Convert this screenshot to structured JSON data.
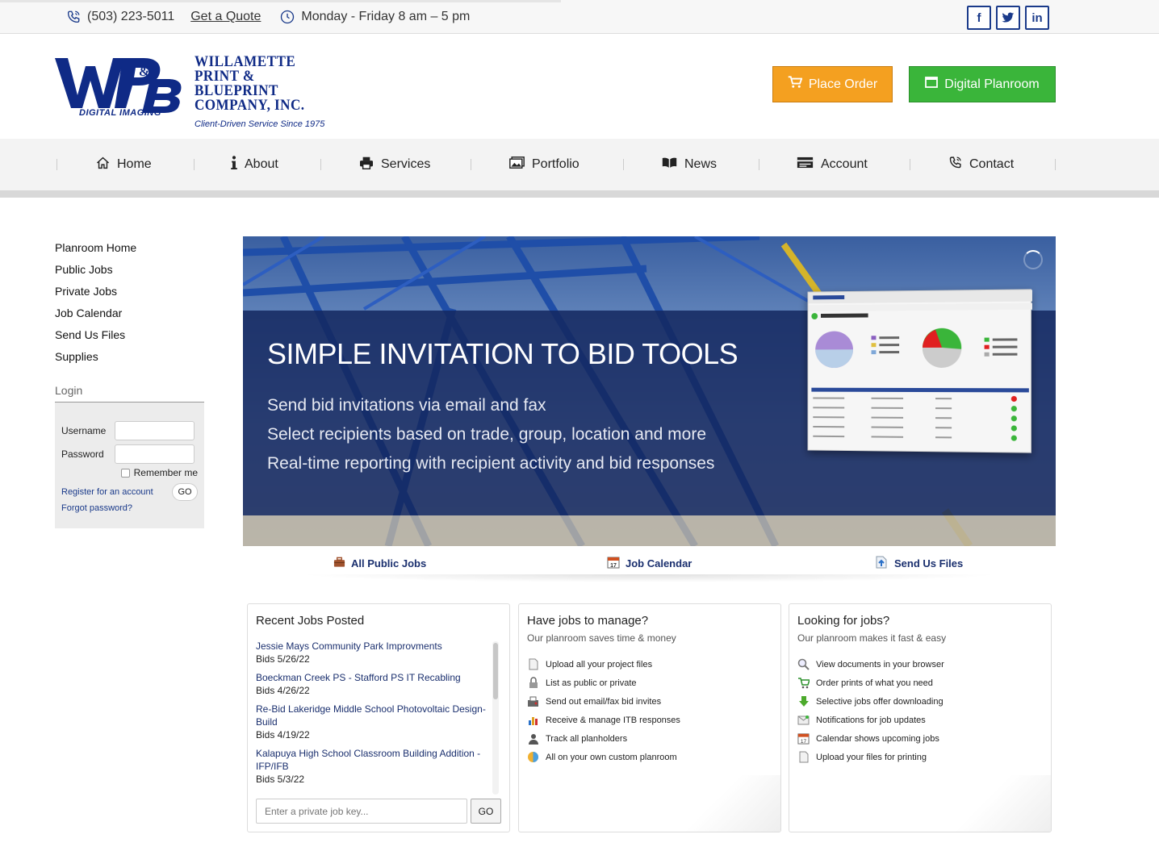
{
  "topbar": {
    "phone": "(503) 223-5011",
    "quote": "Get a Quote",
    "hours": "Monday - Friday 8 am – 5 pm",
    "social": [
      "f",
      "t",
      "in"
    ]
  },
  "logo": {
    "line1": "WILLAMETTE",
    "line2": "PRINT & BLUEPRINT",
    "line3": "COMPANY, INC.",
    "tagline": "Client-Driven Service Since 1975",
    "digital": "DIGITAL IMAGING",
    "mark": "WP&B"
  },
  "header": {
    "place_order": "Place Order",
    "digital_planroom": "Digital Planroom"
  },
  "nav": {
    "items": [
      {
        "label": "Home",
        "icon": "home-icon"
      },
      {
        "label": "About",
        "icon": "info-icon"
      },
      {
        "label": "Services",
        "icon": "printer-icon"
      },
      {
        "label": "Portfolio",
        "icon": "image-icon"
      },
      {
        "label": "News",
        "icon": "book-icon"
      },
      {
        "label": "Account",
        "icon": "card-icon"
      },
      {
        "label": "Contact",
        "icon": "phone-icon"
      }
    ]
  },
  "sidebar": {
    "links": [
      "Planroom Home",
      "Public Jobs",
      "Private Jobs",
      "Job Calendar",
      "Send Us Files",
      "Supplies"
    ],
    "login_title": "Login",
    "username_label": "Username",
    "password_label": "Password",
    "remember": "Remember me",
    "register": "Register for an account",
    "go": "GO",
    "forgot": "Forgot password?"
  },
  "hero": {
    "title": "SIMPLE INVITATION TO BID TOOLS",
    "lines": [
      "Send bid invitations via email and fax",
      "Select recipients based on trade, group, location and more",
      "Real-time reporting with recipient activity and bid responses"
    ]
  },
  "quick_links": [
    "All Public Jobs",
    "Job Calendar",
    "Send Us Files"
  ],
  "recent": {
    "title": "Recent Jobs Posted",
    "jobs": [
      {
        "title": "Jessie Mays Community Park Improvments",
        "bids": "Bids 5/26/22"
      },
      {
        "title": "Boeckman Creek PS - Stafford PS IT Recabling",
        "bids": "Bids 4/26/22"
      },
      {
        "title": "Re-Bid Lakeridge Middle School Photovoltaic Design-Build",
        "bids": "Bids 4/19/22"
      },
      {
        "title": "Kalapuya High School Classroom Building Addition - IFP/IFB",
        "bids": "Bids 5/3/22"
      }
    ],
    "key_placeholder": "Enter a private job key...",
    "go": "GO"
  },
  "manage": {
    "title": "Have jobs to manage?",
    "sub": "Our planroom saves time & money",
    "items": [
      "Upload all your project files",
      "List as public or private",
      "Send out email/fax bid invites",
      "Receive & manage ITB responses",
      "Track all planholders",
      "All on your own custom planroom"
    ]
  },
  "looking": {
    "title": "Looking for jobs?",
    "sub": "Our planroom makes it fast & easy",
    "items": [
      "View documents in your browser",
      "Order prints of what you need",
      "Selective jobs offer downloading",
      "Notifications for job updates",
      "Calendar shows upcoming jobs",
      "Upload your files for printing"
    ]
  }
}
